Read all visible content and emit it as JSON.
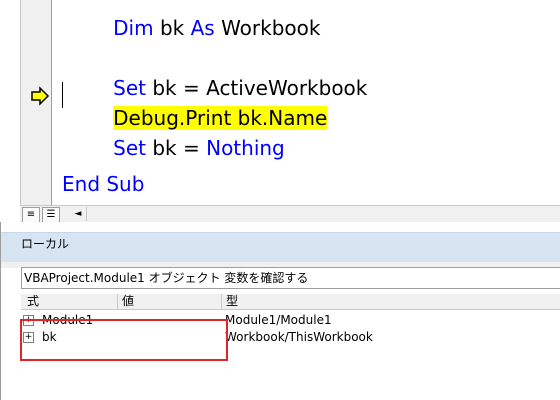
{
  "code": {
    "line_dim": {
      "kw1": "Dim",
      "mid": " bk ",
      "kw2": "As",
      "rest": " Workbook"
    },
    "line_set": {
      "kw": "Set",
      "rest": " bk = ActiveWorkbook"
    },
    "line_debug": "Debug.Print bk.Name",
    "line_nothing": {
      "kw1": "Set",
      "mid": " bk = ",
      "kw2": "Nothing"
    },
    "line_end": "End Sub"
  },
  "view_buttons": {
    "procedure": "≡",
    "module": "☰",
    "left_arrow": "◄"
  },
  "locals": {
    "title": "ローカル",
    "context": "VBAProject.Module1 オブジェクト 変数を確認する",
    "columns": [
      "式",
      "値",
      "型"
    ],
    "rows": [
      {
        "expander": "+",
        "expression": "Module1",
        "value": "",
        "type": "Module1/Module1"
      },
      {
        "expander": "+",
        "expression": "bk",
        "value": "",
        "type": "Workbook/ThisWorkbook"
      }
    ]
  },
  "colors": {
    "keyword": "#0000ff",
    "highlight": "#ffff00",
    "annotation_box": "#e0242a",
    "locals_title_bg": "#d7e4f2"
  }
}
